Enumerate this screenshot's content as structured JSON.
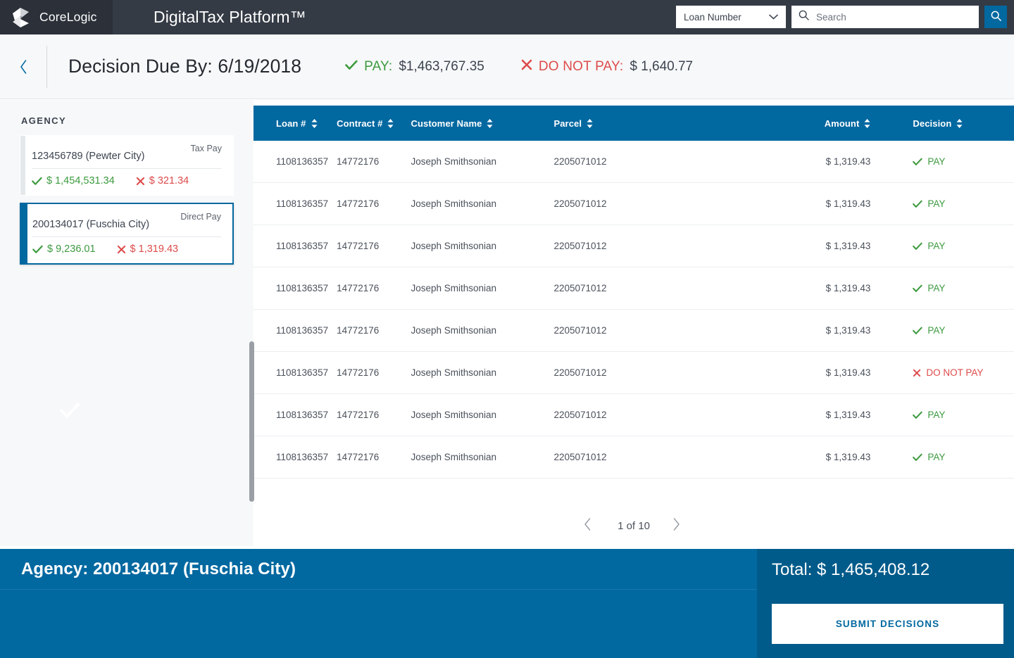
{
  "topbar": {
    "brand_name": "CoreLogic",
    "app_title": "DigitalTax Platform™",
    "search_scope": "Loan Number",
    "search_placeholder": "Search",
    "search_value": "",
    "icons": {
      "logo": "corelogic-logo",
      "chevron": "chevron-down-icon",
      "search": "search-icon",
      "search_submit": "search-submit-icon"
    }
  },
  "subheader": {
    "back_label": "‹",
    "due_title": "Decision Due By: 6/19/2018",
    "pay_label": "PAY:",
    "pay_value": "$1,463,767.35",
    "do_not_pay_label": "DO NOT PAY:",
    "do_not_pay_value": "$ 1,640.77"
  },
  "sidebar": {
    "heading": "AGENCY",
    "agencies": [
      {
        "id": "123456789 (Pewter City)",
        "tag": "Tax Pay",
        "pay_amount": "$ 1,454,531.34",
        "no_pay_amount": "$ 321.34",
        "selected": false
      },
      {
        "id": "200134017 (Fuschia City)",
        "tag": "Direct Pay",
        "pay_amount": "$ 9,236.01",
        "no_pay_amount": "$ 1,319.43",
        "selected": true
      }
    ]
  },
  "table": {
    "columns": [
      {
        "label": "Loan #",
        "key": "loan"
      },
      {
        "label": "Contract #",
        "key": "contract"
      },
      {
        "label": "Customer Name",
        "key": "customer"
      },
      {
        "label": "Parcel",
        "key": "parcel"
      },
      {
        "label": "Amount",
        "key": "amount"
      },
      {
        "label": "Decision",
        "key": "decision"
      }
    ],
    "rows": [
      {
        "loan": "1108136357",
        "contract": "14772176",
        "customer": "Joseph Smithsonian",
        "parcel": "2205071012",
        "amount": "$ 1,319.43",
        "decision": "PAY",
        "decision_state": "pay"
      },
      {
        "loan": "1108136357",
        "contract": "14772176",
        "customer": "Joseph Smithsonian",
        "parcel": "2205071012",
        "amount": "$ 1,319.43",
        "decision": "PAY",
        "decision_state": "pay"
      },
      {
        "loan": "1108136357",
        "contract": "14772176",
        "customer": "Joseph Smithsonian",
        "parcel": "2205071012",
        "amount": "$ 1,319.43",
        "decision": "PAY",
        "decision_state": "pay"
      },
      {
        "loan": "1108136357",
        "contract": "14772176",
        "customer": "Joseph Smithsonian",
        "parcel": "2205071012",
        "amount": "$ 1,319.43",
        "decision": "PAY",
        "decision_state": "pay"
      },
      {
        "loan": "1108136357",
        "contract": "14772176",
        "customer": "Joseph Smithsonian",
        "parcel": "2205071012",
        "amount": "$ 1,319.43",
        "decision": "PAY",
        "decision_state": "pay"
      },
      {
        "loan": "1108136357",
        "contract": "14772176",
        "customer": "Joseph Smithsonian",
        "parcel": "2205071012",
        "amount": "$ 1,319.43",
        "decision": "DO NOT PAY",
        "decision_state": "nopay"
      },
      {
        "loan": "1108136357",
        "contract": "14772176",
        "customer": "Joseph Smithsonian",
        "parcel": "2205071012",
        "amount": "$ 1,319.43",
        "decision": "PAY",
        "decision_state": "pay"
      },
      {
        "loan": "1108136357",
        "contract": "14772176",
        "customer": "Joseph Smithsonian",
        "parcel": "2205071012",
        "amount": "$ 1,319.43",
        "decision": "PAY",
        "decision_state": "pay"
      }
    ]
  },
  "pagination": {
    "prev_label": "‹",
    "next_label": "›",
    "status": "1 of 10",
    "current_page": 1,
    "total_pages": 10
  },
  "bottombar": {
    "agency_label": "Agency: 200134017 (Fuschia City)",
    "total_label": "Total: $ 1,465,408.12",
    "submit_label": "SUBMIT DECISIONS"
  },
  "colors": {
    "brand_blue": "#0268a0",
    "brand_blue_dark": "#015b8a",
    "topbar": "#353b45",
    "topbar_brand": "#2b3039",
    "pay_green": "#3c9a3f",
    "nopay_red": "#dd4b4b",
    "page_bg": "#f7f8f9"
  }
}
